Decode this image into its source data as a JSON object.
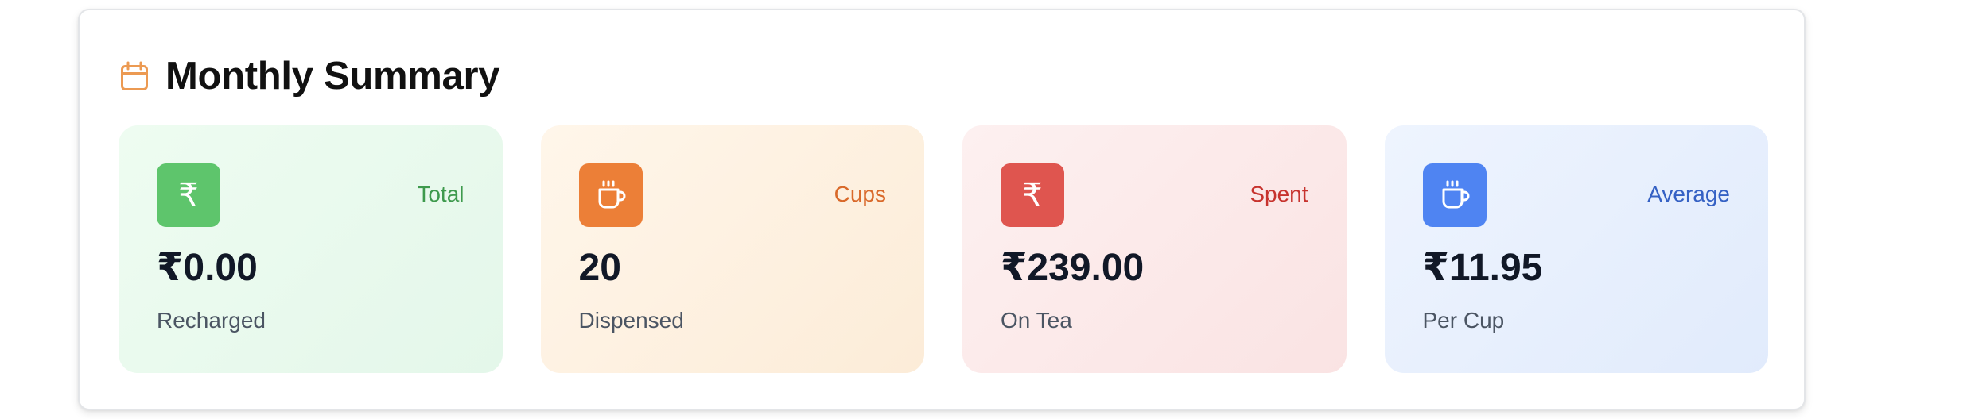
{
  "summary": {
    "title": "Monthly Summary",
    "header_icon": "calendar-icon",
    "accent_color": "#ec9a52"
  },
  "stats": [
    {
      "icon": "rupee-icon",
      "tag": "Total",
      "value": "₹0.00",
      "label": "Recharged",
      "color": "#5ec56c"
    },
    {
      "icon": "cup-icon",
      "tag": "Cups",
      "value": "20",
      "label": "Dispensed",
      "color": "#ec7f37"
    },
    {
      "icon": "rupee-icon",
      "tag": "Spent",
      "value": "₹239.00",
      "label": "On Tea",
      "color": "#df554f"
    },
    {
      "icon": "cup-icon",
      "tag": "Average",
      "value": "₹11.95",
      "label": "Per Cup",
      "color": "#4f84f2"
    }
  ]
}
